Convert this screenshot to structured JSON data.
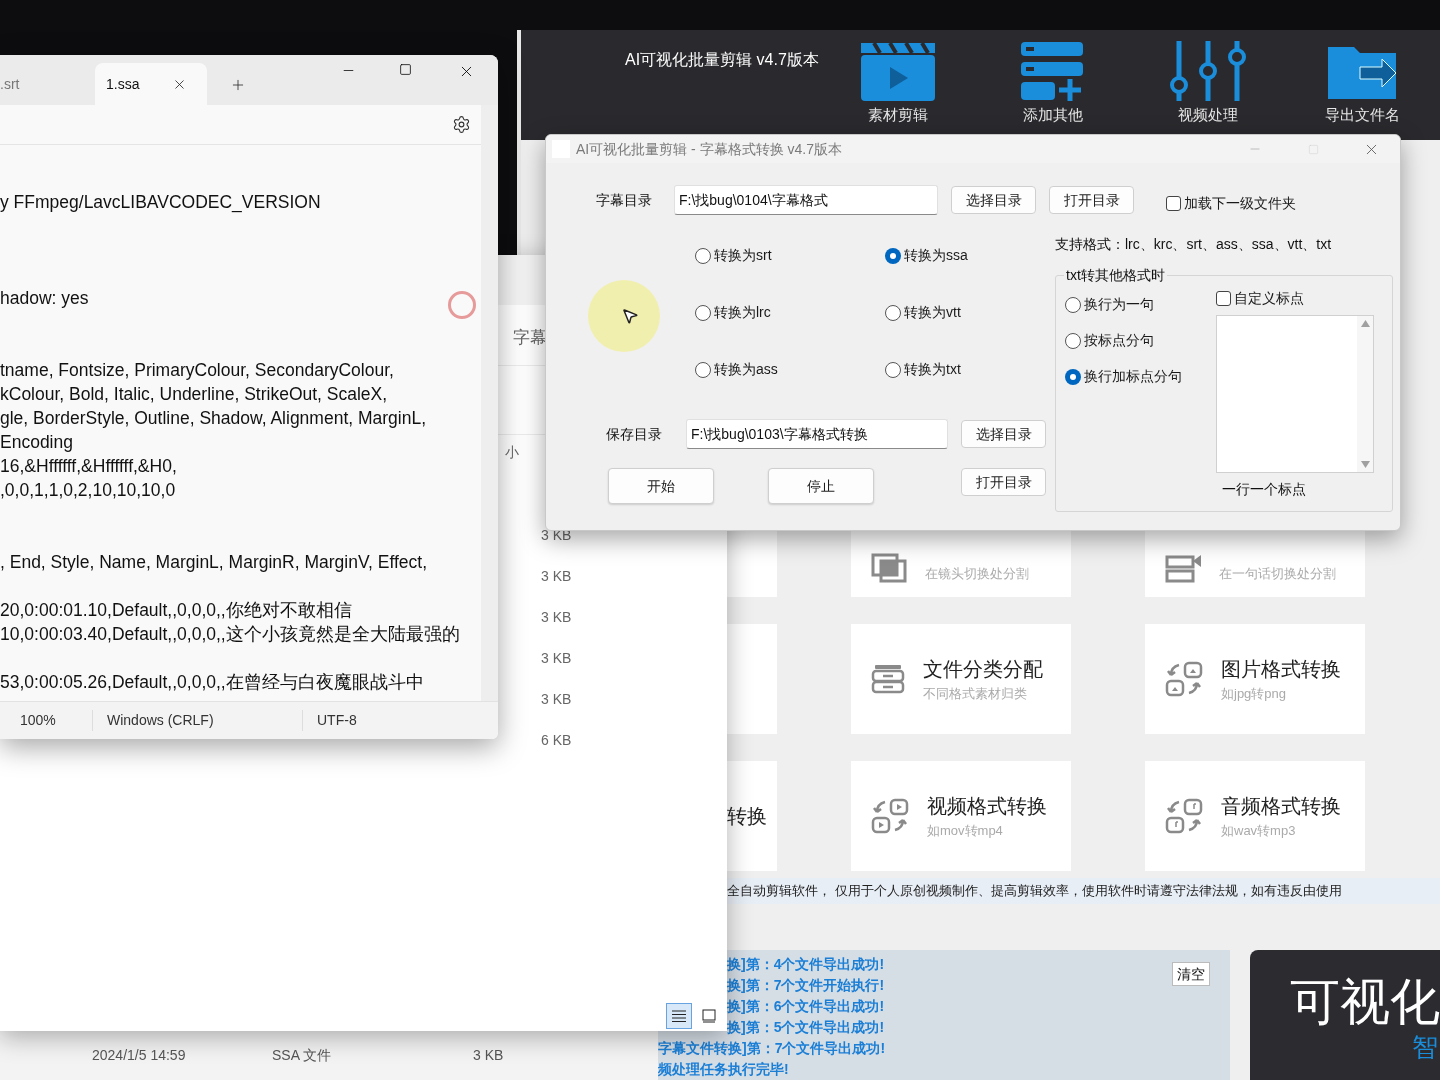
{
  "notepad": {
    "tabs": [
      {
        "label": ".srt",
        "selected": false
      },
      {
        "label": "1.ssa",
        "selected": true
      }
    ],
    "blocks": [
      {
        "lines": [
          "y FFmpeg/LavcLIBAVCODEC_VERSION"
        ]
      },
      {
        "lines": [
          "hadow: yes"
        ]
      },
      {
        "lines": [
          "tname, Fontsize, PrimaryColour, SecondaryColour,",
          "kColour, Bold, Italic, Underline, StrikeOut, ScaleX,",
          "gle, BorderStyle, Outline, Shadow, Alignment, MarginL,",
          "Encoding",
          "16,&Hffffff,&Hffffff,&H0,",
          ",0,0,1,1,0,2,10,10,10,0"
        ]
      },
      {
        "lines": [
          ", End, Style, Name, MarginL, MarginR, MarginV, Effect,"
        ]
      },
      {
        "lines": [
          "20,0:00:01.10,Default,,0,0,0,,你绝对不敢相信",
          "10,0:00:03.40,Default,,0,0,0,,这个小孩竟然是全大陆最强的"
        ]
      },
      {
        "lines": [
          "53,0:00:05.26,Default,,0,0,0,,在曾经与白夜魔眼战斗中"
        ]
      }
    ],
    "status_bar": [
      "100%",
      "Windows (CRLF)",
      "UTF-8"
    ]
  },
  "explorer": {
    "header_fragment": "字幕",
    "column_fragment": "小",
    "sizes": [
      "3 KB",
      "3 KB",
      "3 KB",
      "3 KB",
      "3 KB",
      "6 KB"
    ],
    "views": [
      {
        "kind": "details",
        "selected": true
      },
      {
        "kind": "tiles",
        "selected": false
      }
    ]
  },
  "bottom_explorer_row": {
    "date": "2024/1/5 14:59",
    "type": "SSA 文件",
    "size": "3 KB"
  },
  "app": {
    "title": "AI可视化批量剪辑 v4.7版本",
    "tools": [
      {
        "kind": "clapper",
        "label": "素材剪辑"
      },
      {
        "kind": "add-list",
        "label": "添加其他"
      },
      {
        "kind": "sliders",
        "label": "视频处理"
      },
      {
        "kind": "export",
        "label": "导出文件名"
      }
    ],
    "cards": [
      {
        "kind": "blank"
      },
      {
        "kind": "split-shot",
        "subtitle": "在镜头切换处分割"
      },
      {
        "kind": "split-sentence",
        "subtitle": "在一句话切换处分割"
      },
      {
        "kind": "blank"
      },
      {
        "kind": "sort",
        "title": "文件分类分配",
        "subtitle": "不同格式素材归类"
      },
      {
        "kind": "image",
        "title": "图片格式转换",
        "subtitle": "如jpg转png"
      },
      {
        "kind": "blank",
        "title": "转换"
      },
      {
        "kind": "video",
        "title": "视频格式转换",
        "subtitle": "如mov转mp4"
      },
      {
        "kind": "audio",
        "title": "音频格式转换",
        "subtitle": "如wav转mp3"
      }
    ],
    "notice": "全自动剪辑软件， 仅用于个人原创视频制作、提高剪辑效率，使用软件时请遵守法律法规，如有违反由使用",
    "log": {
      "clear_button": "清空",
      "lines": [
        "换]第：4个文件导出成功!",
        "换]第：7个文件开始执行!",
        "换]第：6个文件导出成功!",
        "换]第：5个文件导出成功!",
        "字幕文件转换]第：7个文件导出成功!",
        "频处理任务执行完毕!"
      ]
    },
    "promo": {
      "title": "可视化",
      "subtitle": "智"
    }
  },
  "dialog": {
    "title": "AI可视化批量剪辑 -  字幕格式转换  v4.7版本",
    "source": {
      "label": "字幕目录",
      "value": "F:\\找bug\\0104\\字幕格式",
      "choose_button": "选择目录",
      "open_button": "打开目录"
    },
    "subfolder": {
      "label": "加载下一级文件夹",
      "checked": false
    },
    "supported": "支持格式：lrc、krc、srt、ass、ssa、vtt、txt",
    "formats": [
      {
        "label": "转换为srt",
        "selected": false
      },
      {
        "label": "转换为ssa",
        "selected": true
      },
      {
        "label": "转换为lrc",
        "selected": false
      },
      {
        "label": "转换为vtt",
        "selected": false
      },
      {
        "label": "转换为ass",
        "selected": false
      },
      {
        "label": "转换为txt",
        "selected": false
      }
    ],
    "txt_group": {
      "legend": "txt转其他格式时",
      "modes": [
        {
          "label": "换行为一句",
          "selected": false
        },
        {
          "label": "按标点分句",
          "selected": false
        },
        {
          "label": "换行加标点分句",
          "selected": true
        }
      ],
      "custom": {
        "label": "自定义标点",
        "checked": false
      },
      "hint": "一行一个标点"
    },
    "save": {
      "label": "保存目录",
      "value": "F:\\找bug\\0103\\字幕格式转换",
      "choose_button": "选择目录",
      "open_button": "打开目录"
    },
    "start_button": "开始",
    "stop_button": "停止"
  }
}
